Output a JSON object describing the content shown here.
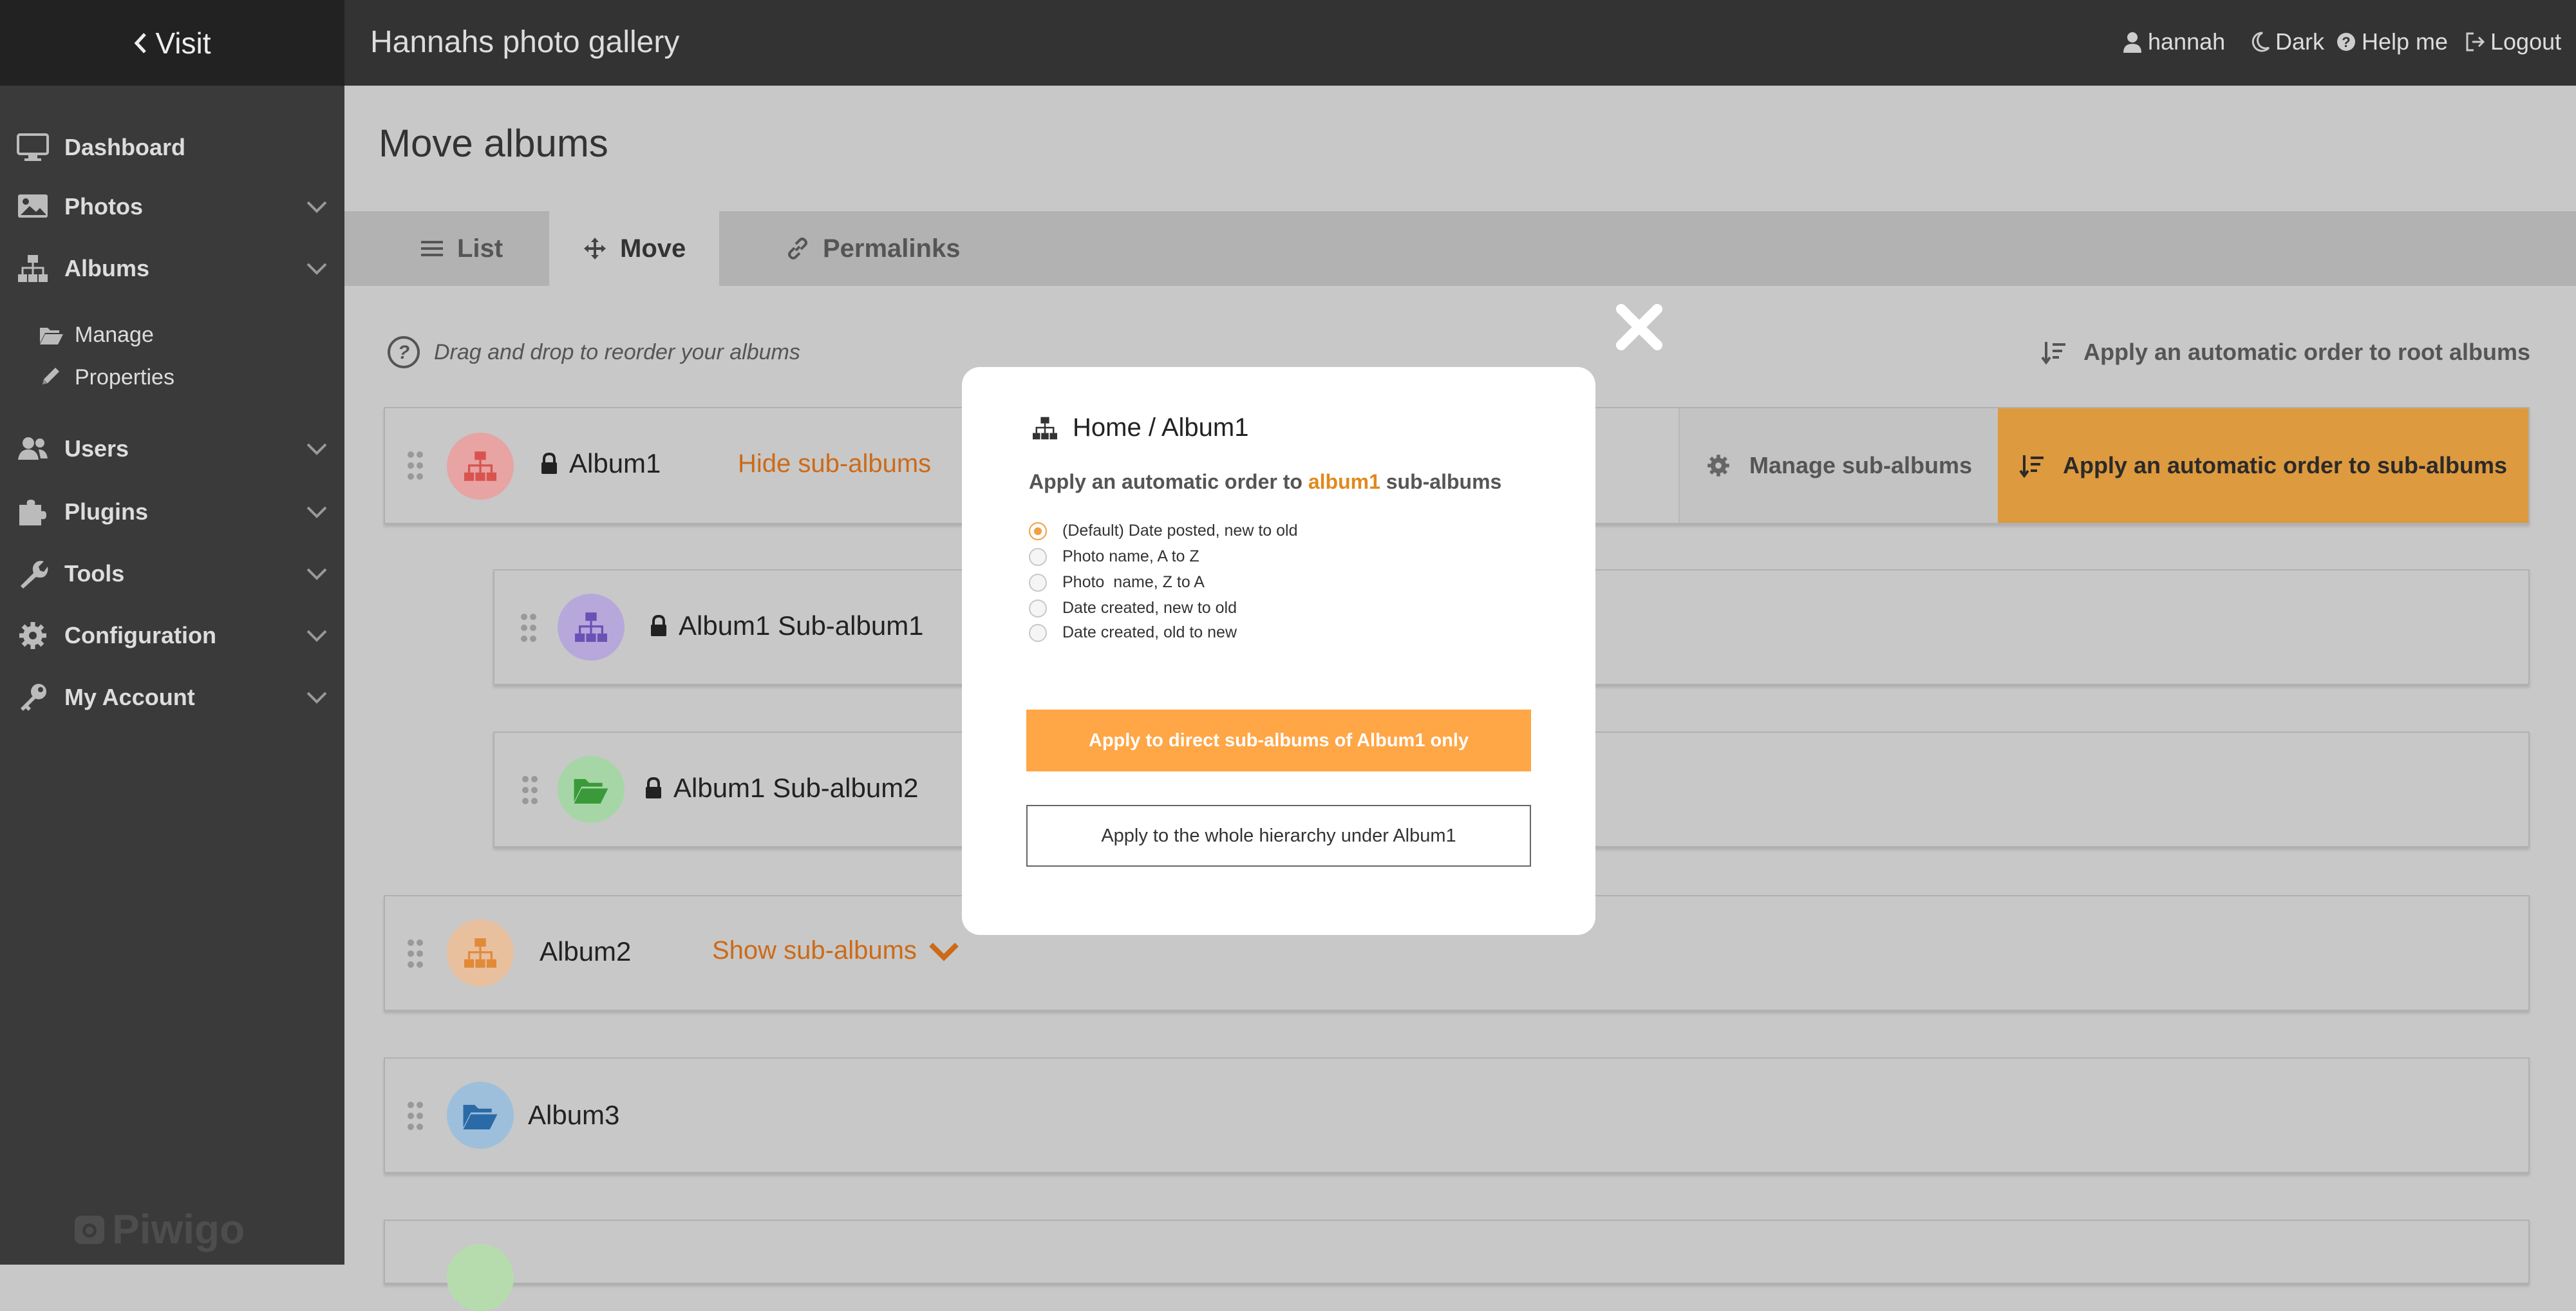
{
  "sidebar": {
    "visit_label": "Visit",
    "items": [
      {
        "label": "Dashboard",
        "icon": "monitor-icon"
      },
      {
        "label": "Photos",
        "icon": "image-icon"
      },
      {
        "label": "Albums",
        "icon": "sitemap-icon"
      },
      {
        "label": "Users",
        "icon": "users-icon"
      },
      {
        "label": "Plugins",
        "icon": "puzzle-icon"
      },
      {
        "label": "Tools",
        "icon": "wrench-icon"
      },
      {
        "label": "Configuration",
        "icon": "gear-icon"
      },
      {
        "label": "My Account",
        "icon": "key-icon"
      }
    ],
    "album_sub": [
      {
        "label": "Manage",
        "icon": "folder-open-icon"
      },
      {
        "label": "Properties",
        "icon": "pencil-icon"
      }
    ],
    "logo": "Piwigo"
  },
  "topbar": {
    "gallery_title": "Hannahs photo gallery",
    "user": "hannah",
    "theme": "Dark",
    "help": "Help me",
    "logout": "Logout"
  },
  "page": {
    "title": "Move albums",
    "tabs": [
      {
        "label": "List",
        "icon": "list-icon"
      },
      {
        "label": "Move",
        "icon": "arrows-move-icon",
        "active": true
      },
      {
        "label": "Permalinks",
        "icon": "link-icon"
      }
    ],
    "help_text": "Drag and drop to reorder your albums",
    "root_order_label": "Apply an automatic order to root albums"
  },
  "albums": {
    "album1": {
      "name": "Album1",
      "toggle": "Hide sub-albums",
      "manage": "Manage sub-albums",
      "apply": "Apply an automatic order to sub-albums"
    },
    "sub1": {
      "name": "Album1 Sub-album1"
    },
    "sub2": {
      "name": "Album1 Sub-album2"
    },
    "album2": {
      "name": "Album2",
      "toggle": "Show sub-albums"
    },
    "album3": {
      "name": "Album3"
    }
  },
  "modal": {
    "breadcrumb": "Home / Album1",
    "subtitle_pre": "Apply an automatic order to ",
    "subtitle_album": "album1",
    "subtitle_post": " sub-albums",
    "options": [
      {
        "label": "(Default) Date posted, new to old",
        "selected": true
      },
      {
        "label": "Photo name, A to Z",
        "selected": false
      },
      {
        "label": "Photo  name, Z to A",
        "selected": false
      },
      {
        "label": "Date created, new to old",
        "selected": false
      },
      {
        "label": "Date created, old to new",
        "selected": false
      }
    ],
    "btn_direct": "Apply to direct sub-albums of Album1 only",
    "btn_whole": "Apply to the whole hierarchy under Album1"
  },
  "colors": {
    "accent_orange": "#de9a3e",
    "button_orange": "#ffa646",
    "sidebar_bg": "#3a3a3a",
    "topbar_bg": "#333333"
  }
}
